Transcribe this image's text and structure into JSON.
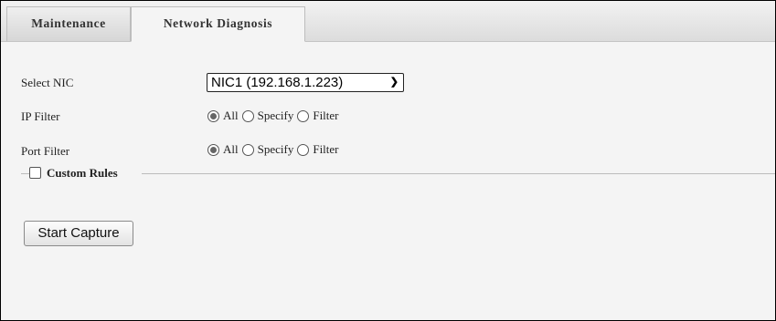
{
  "tabs": [
    {
      "label": "Maintenance",
      "active": false
    },
    {
      "label": "Network Diagnosis",
      "active": true
    }
  ],
  "form": {
    "nic": {
      "label": "Select NIC",
      "selected": "NIC1 (192.168.1.223)"
    },
    "ip_filter": {
      "label": "IP Filter",
      "options": [
        "All",
        "Specify",
        "Filter"
      ],
      "selected": "All"
    },
    "port_filter": {
      "label": "Port Filter",
      "options": [
        "All",
        "Specify",
        "Filter"
      ],
      "selected": "All"
    },
    "custom_rules": {
      "label": "Custom Rules",
      "checked": false
    }
  },
  "actions": {
    "start_capture": "Start Capture"
  },
  "icons": {
    "select_arrow": "chevron-down-icon"
  }
}
